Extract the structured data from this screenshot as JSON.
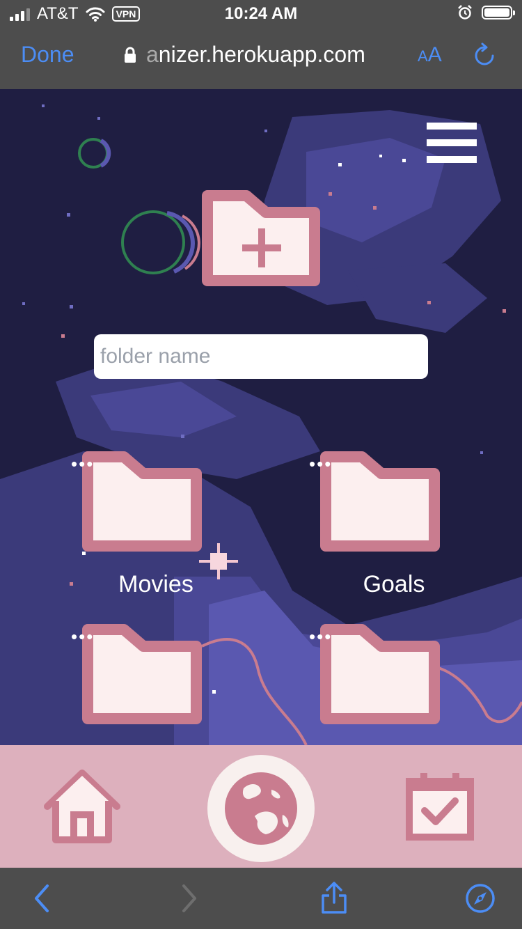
{
  "status_bar": {
    "carrier": "AT&T",
    "vpn": "VPN",
    "time": "10:24 AM"
  },
  "browser": {
    "done_label": "Done",
    "url_faded": "a",
    "url_main": "nizer.herokuapp.com",
    "text_size_small": "A",
    "text_size_large": "A"
  },
  "app": {
    "folder_input": {
      "placeholder": "folder name",
      "value": ""
    },
    "folders": [
      {
        "label": "Movies"
      },
      {
        "label": "Goals"
      },
      {
        "label": ""
      },
      {
        "label": ""
      }
    ],
    "more_glyph": "•••"
  },
  "colors": {
    "accent": "#4c8df5",
    "folder_stroke": "#c97c8f",
    "folder_fill": "#fcefef",
    "tabbar": "#ddb0bd",
    "browser_chrome": "#4d4d4d",
    "space_bg": "#1f1e42"
  },
  "icons": [
    "signal-icon",
    "wifi-icon",
    "alarm-icon",
    "battery-icon",
    "lock-icon",
    "reload-icon",
    "hamburger-menu-icon",
    "add-folder-icon",
    "folder-icon",
    "home-icon",
    "globe-icon",
    "calendar-check-icon",
    "back-icon",
    "forward-icon",
    "share-icon",
    "compass-icon"
  ]
}
